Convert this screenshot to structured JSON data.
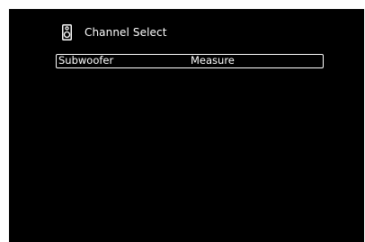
{
  "header": {
    "icon": "speaker-icon",
    "title": "Channel Select"
  },
  "menu": {
    "items": [
      {
        "label": "Subwoofer",
        "value": "Measure",
        "selected": true
      }
    ]
  },
  "colors": {
    "screen_background": "#000000",
    "frame": "#ffffff",
    "text": "#ffffff"
  }
}
